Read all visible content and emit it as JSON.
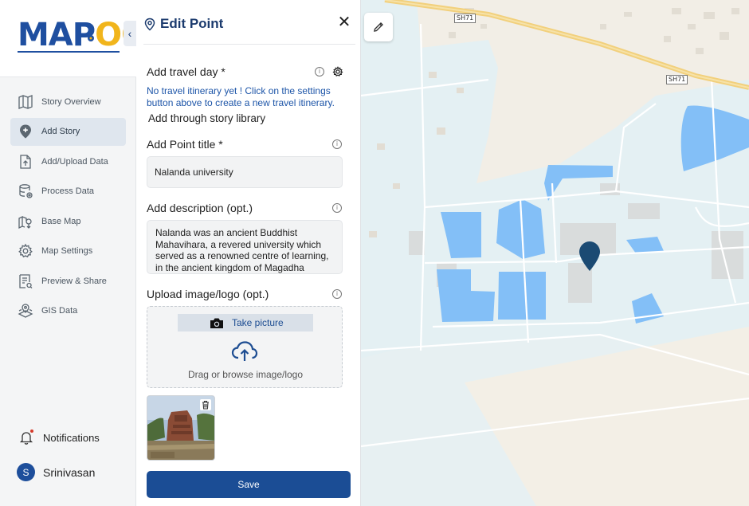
{
  "app": {
    "logo_main": "MAP",
    "logo_accent": "OG"
  },
  "sidebar": {
    "items": [
      {
        "label": "Story Overview",
        "icon": "map-icon",
        "active": false
      },
      {
        "label": "Add Story",
        "icon": "add-location-icon",
        "active": true
      },
      {
        "label": "Add/Upload Data",
        "icon": "upload-file-icon",
        "active": false
      },
      {
        "label": "Process Data",
        "icon": "process-data-icon",
        "active": false
      },
      {
        "label": "Base Map",
        "icon": "base-map-icon",
        "active": false
      },
      {
        "label": "Map Settings",
        "icon": "gear-icon",
        "active": false
      },
      {
        "label": "Preview & Share",
        "icon": "preview-share-icon",
        "active": false
      },
      {
        "label": "GIS Data",
        "icon": "gis-data-icon",
        "active": false
      }
    ],
    "notifications_label": "Notifications",
    "user": {
      "initial": "S",
      "name": "Srinivasan"
    }
  },
  "panel": {
    "title": "Edit Point",
    "travel_day_label": "Add travel day *",
    "travel_day_message": "No travel itinerary yet ! Click on the settings button above to create a new travel itinerary.",
    "library_link": "Add through story library",
    "point_title_label": "Add Point title *",
    "point_title_value": "Nalanda university",
    "description_label": "Add description (opt.)",
    "description_value": "Nalanda was an ancient Buddhist Mahavihara, a revered university which served as a renowned centre of learning, in the ancient kingdom of Magadha",
    "upload_label": "Upload image/logo (opt.)",
    "take_picture_label": "Take picture",
    "drag_browse_label": "Drag or browse image/logo",
    "save_label": "Save"
  },
  "map": {
    "road_labels": [
      "SH71",
      "SH71"
    ],
    "colors": {
      "land": "#f3efe8",
      "campus": "#e6f1f3",
      "water": "#83bff7",
      "marker": "#1b4a73",
      "road": "#f2d07c"
    }
  }
}
